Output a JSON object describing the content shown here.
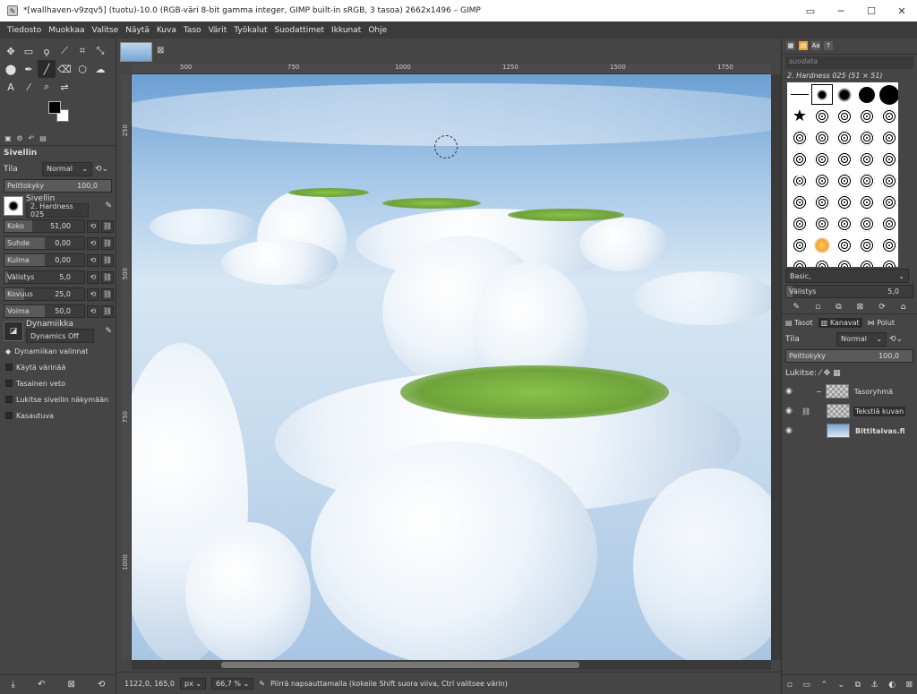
{
  "window": {
    "title": "*[wallhaven-v9zqv5] (tuotu)-10.0 (RGB-väri 8-bit gamma integer, GIMP built-in sRGB, 3 tasoa) 2662x1496 – GIMP",
    "app_icon": "gimp-icon",
    "controls": [
      "▭",
      "─",
      "☐",
      "✕"
    ]
  },
  "menu": [
    "Tiedosto",
    "Muokkaa",
    "Valitse",
    "Näytä",
    "Kuva",
    "Taso",
    "Värit",
    "Työkalut",
    "Suodattimet",
    "Ikkunat",
    "Ohje"
  ],
  "toolbox": {
    "tools": [
      "✥",
      "▭",
      "ϙ",
      "⟋",
      "⌗",
      "⤡",
      "⬤",
      "✒",
      "╱",
      "⌫",
      "⬡",
      "☁",
      "A",
      "⁄",
      "⌕",
      "⇌",
      "",
      ""
    ],
    "colors": {
      "foreground": "#000000",
      "background": "#ffffff"
    },
    "section_title": "Sivellin",
    "mode_label": "Tila",
    "mode_value": "Normal",
    "opacity_label": "Peittokyky",
    "opacity_value": "100,0",
    "brush_label": "Sivellin",
    "brush_value": "2. Hardness 025",
    "sliders": [
      {
        "label": "Koko",
        "value": "51,00",
        "fill": 0.35
      },
      {
        "label": "Suhde",
        "value": "0,00",
        "fill": 0.5
      },
      {
        "label": "Kulma",
        "value": "0,00",
        "fill": 0.5
      },
      {
        "label": "Välistys",
        "value": "5,0",
        "fill": 0.05
      },
      {
        "label": "Kovuus",
        "value": "25,0",
        "fill": 0.25
      },
      {
        "label": "Voima",
        "value": "50,0",
        "fill": 0.5
      }
    ],
    "dynamics_label": "Dynamiikka",
    "dynamics_value": "Dynamics Off",
    "dynamics_options": "Dynamiikan valinnat",
    "checks": [
      "Käytä värinää",
      "Tasainen veto",
      "Lukitse sivellin näkymään",
      "Kasautuva"
    ]
  },
  "canvas": {
    "ruler_ticks": [
      "500",
      "750",
      "1000",
      "1250",
      "1500",
      "1750"
    ],
    "vruler_ticks": [
      "250",
      "500",
      "750",
      "1000"
    ],
    "status": {
      "coords": "1122,0, 165,0",
      "unit": "px",
      "zoom": "66,7 %",
      "message": "Piirrä napsauttamalla (kokeile Shift suora viiva, Ctrl valitsee värin)"
    }
  },
  "brushes": {
    "filter_placeholder": "suodata",
    "current": "2. Hardness 025 (51 × 51)",
    "preset": "Basic,",
    "spacing_label": "Välistys",
    "spacing_value": "5,0"
  },
  "layers": {
    "tabs": [
      "Tasot",
      "Kanavat",
      "Polut"
    ],
    "mode_label": "Tila",
    "mode_value": "Normal",
    "opacity_label": "Peittokyky",
    "opacity_value": "100,0",
    "lock_label": "Lukitse:",
    "items": [
      {
        "name": "Tasoryhmä",
        "expander": "−"
      },
      {
        "name": "Tekstiä kuvan",
        "linked": "⛓"
      },
      {
        "name": "Bittitaivas.fi"
      }
    ]
  }
}
